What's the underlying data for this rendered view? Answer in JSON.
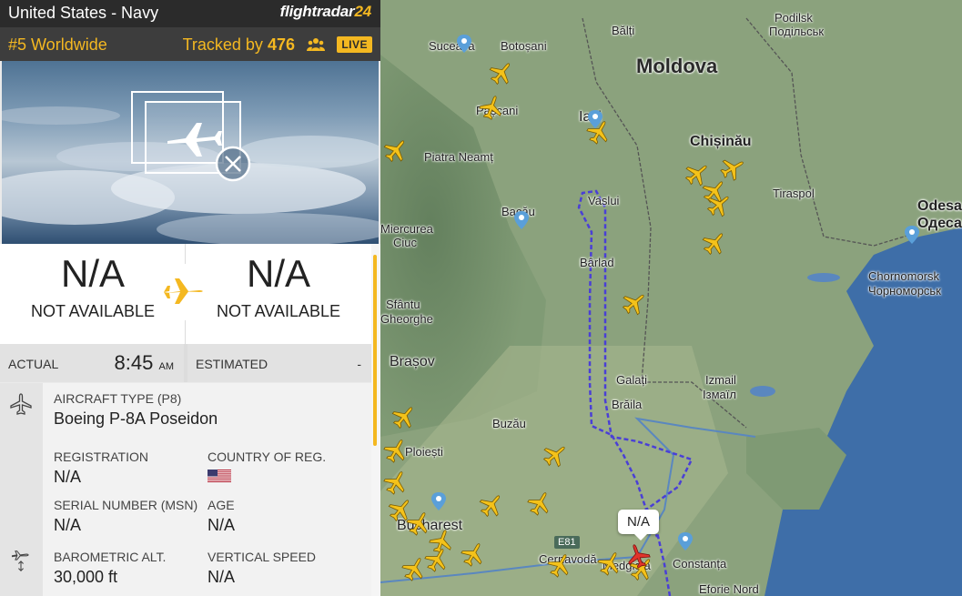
{
  "header": {
    "title": "United States - Navy",
    "logo_text": "flightradar",
    "logo_num": "24"
  },
  "rank": {
    "label": "#5 Worldwide",
    "tracked_prefix": "Tracked by",
    "tracked_count": "476",
    "live": "LIVE"
  },
  "route": {
    "origin_code": "N/A",
    "origin_name": "NOT AVAILABLE",
    "dest_code": "N/A",
    "dest_name": "NOT AVAILABLE"
  },
  "times": {
    "actual_label": "ACTUAL",
    "actual_time": "8:45",
    "actual_ampm": "AM",
    "estimated_label": "ESTIMATED",
    "estimated_value": "-"
  },
  "details": {
    "aircraft_type_label": "AIRCRAFT TYPE (P8)",
    "aircraft_type_value": "Boeing P-8A Poseidon",
    "registration_label": "REGISTRATION",
    "registration_value": "N/A",
    "country_label": "COUNTRY OF REG.",
    "msn_label": "SERIAL NUMBER (MSN)",
    "msn_value": "N/A",
    "age_label": "AGE",
    "age_value": "N/A",
    "baro_label": "BAROMETRIC ALT.",
    "baro_value": "30,000 ft",
    "vspeed_label": "VERTICAL SPEED",
    "vspeed_value": "N/A"
  },
  "map": {
    "callout": "N/A",
    "road": "E81",
    "labels": {
      "moldova": "Moldova",
      "balti": "Bălți",
      "podilsk": "Podilsk",
      "podilsk_cyr": "Подільськ",
      "suceava": "Suceava",
      "botosani": "Botoșani",
      "pascani": "Pașcani",
      "iasi": "Iași",
      "chisinau": "Chișinău",
      "tiraspol": "Tiraspol",
      "piatra": "Piatra Neamț",
      "vaslui": "Vaslui",
      "bacau": "Bacău",
      "odesa": "Odesa",
      "odesa_cyr": "Одеса",
      "miercurea": "Miercurea",
      "ciuc": "Ciuc",
      "barlad": "Bârlad",
      "chornomorsk": "Chornomorsk",
      "chornomorsk_cyr": "Чорноморськ",
      "sfantu": "Sfântu",
      "gheorghe": "Gheorghe",
      "brasov": "Brașov",
      "izmail": "Izmail",
      "izmail_cyr": "Ізмаїл",
      "galati": "Galați",
      "braila": "Brăila",
      "buzau": "Buzău",
      "ploiesti": "Ploiești",
      "bucharest": "Bucharest",
      "cernavoda": "Cernavodă",
      "medgidia": "Medgidia",
      "constanta": "Constanța",
      "eforie": "Eforie Nord"
    }
  },
  "colors": {
    "accent": "#f4b821",
    "track": "#4a3fd6",
    "sea": "#3e6ea8"
  }
}
